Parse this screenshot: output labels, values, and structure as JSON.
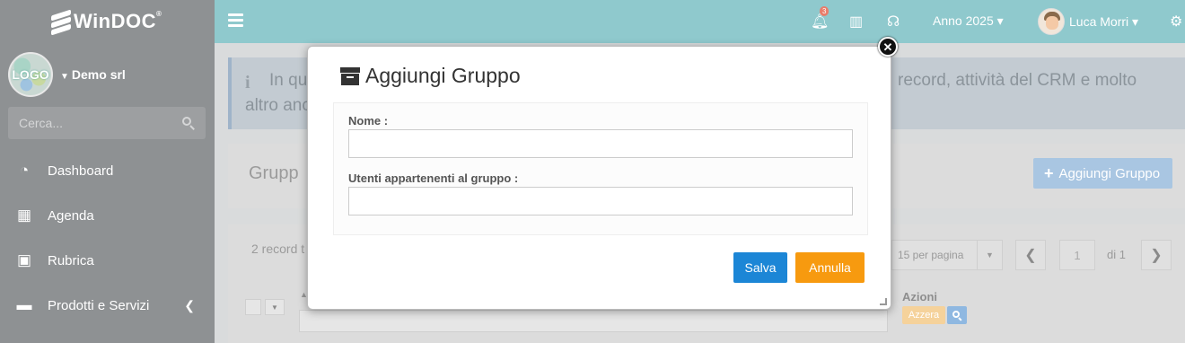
{
  "app": {
    "logo_text": "WinDOC",
    "logo_mark": "®"
  },
  "sidebar": {
    "company": "Demo srl",
    "company_logo_text": "LOGO",
    "search_placeholder": "Cerca...",
    "items": [
      {
        "label": "Dashboard",
        "icon": "dashboard-icon"
      },
      {
        "label": "Agenda",
        "icon": "calendar-icon"
      },
      {
        "label": "Rubrica",
        "icon": "address-book-icon"
      },
      {
        "label": "Prodotti e Servizi",
        "icon": "box-icon"
      }
    ]
  },
  "header": {
    "notifications_count": "3",
    "year": "Anno 2025",
    "user": "Luca Morri"
  },
  "background": {
    "info_text": "In qu",
    "info_text_right": "record, attività del CRM e molto",
    "info_text_line2": "altro anc",
    "page_title": "Grupp",
    "add_button": "Aggiungi Gruppo",
    "records": "2 record t",
    "per_page": "15 per pagina",
    "page_current": "1",
    "page_of": "di 1",
    "actions_label": "Azioni",
    "reset_label": "Azzera"
  },
  "modal": {
    "title": "Aggiungi Gruppo",
    "name_label": "Nome :",
    "name_value": "",
    "users_label": "Utenti appartenenti al gruppo :",
    "users_value": "",
    "save_label": "Salva",
    "cancel_label": "Annulla"
  },
  "colors": {
    "header": "#8fc9cd",
    "sidebar": "#8e9193",
    "save": "#1c86d6",
    "cancel": "#f79a0f"
  }
}
